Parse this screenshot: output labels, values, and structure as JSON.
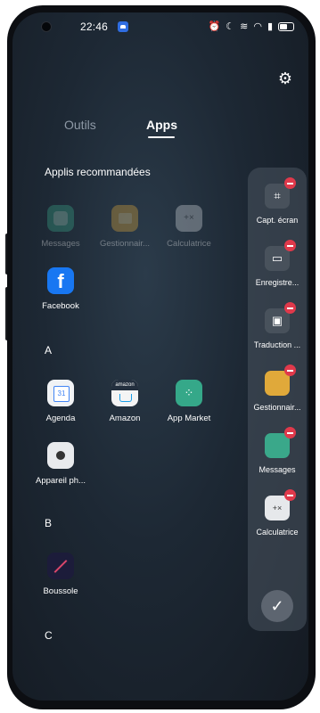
{
  "status": {
    "time": "22:46"
  },
  "tabs": [
    {
      "label": "Outils",
      "active": false
    },
    {
      "label": "Apps",
      "active": true
    }
  ],
  "recommended": {
    "title": "Applis recommandées",
    "apps": [
      {
        "label": "Messages",
        "icon": "messages-icon",
        "color": "#3aa88a"
      },
      {
        "label": "Gestionnair...",
        "icon": "folder-icon",
        "color": "#e0a93a"
      },
      {
        "label": "Calculatrice",
        "icon": "calculator-icon",
        "color": "#d6d9de"
      }
    ],
    "facebook": {
      "label": "Facebook",
      "icon": "facebook-icon",
      "color": "#1877f2"
    }
  },
  "sections": [
    {
      "letter": "A",
      "apps": [
        {
          "label": "Agenda",
          "icon": "calendar-icon"
        },
        {
          "label": "Amazon",
          "icon": "amazon-icon"
        },
        {
          "label": "App Market",
          "icon": "app-market-icon"
        },
        {
          "label": "Appareil ph...",
          "icon": "camera-icon"
        }
      ]
    },
    {
      "letter": "B",
      "apps": [
        {
          "label": "Boussole",
          "icon": "compass-icon"
        }
      ]
    },
    {
      "letter": "C",
      "apps": []
    }
  ],
  "floating_panel": {
    "items": [
      {
        "label": "Capt. écran",
        "icon": "screenshot-icon"
      },
      {
        "label": "Enregistre...",
        "icon": "screen-record-icon"
      },
      {
        "label": "Traduction ...",
        "icon": "translate-icon"
      },
      {
        "label": "Gestionnair...",
        "icon": "folder-icon"
      },
      {
        "label": "Messages",
        "icon": "messages-icon"
      },
      {
        "label": "Calculatrice",
        "icon": "calculator-icon"
      }
    ]
  },
  "amazon_icon_text": "amazon",
  "calendar_icon_text": "31"
}
